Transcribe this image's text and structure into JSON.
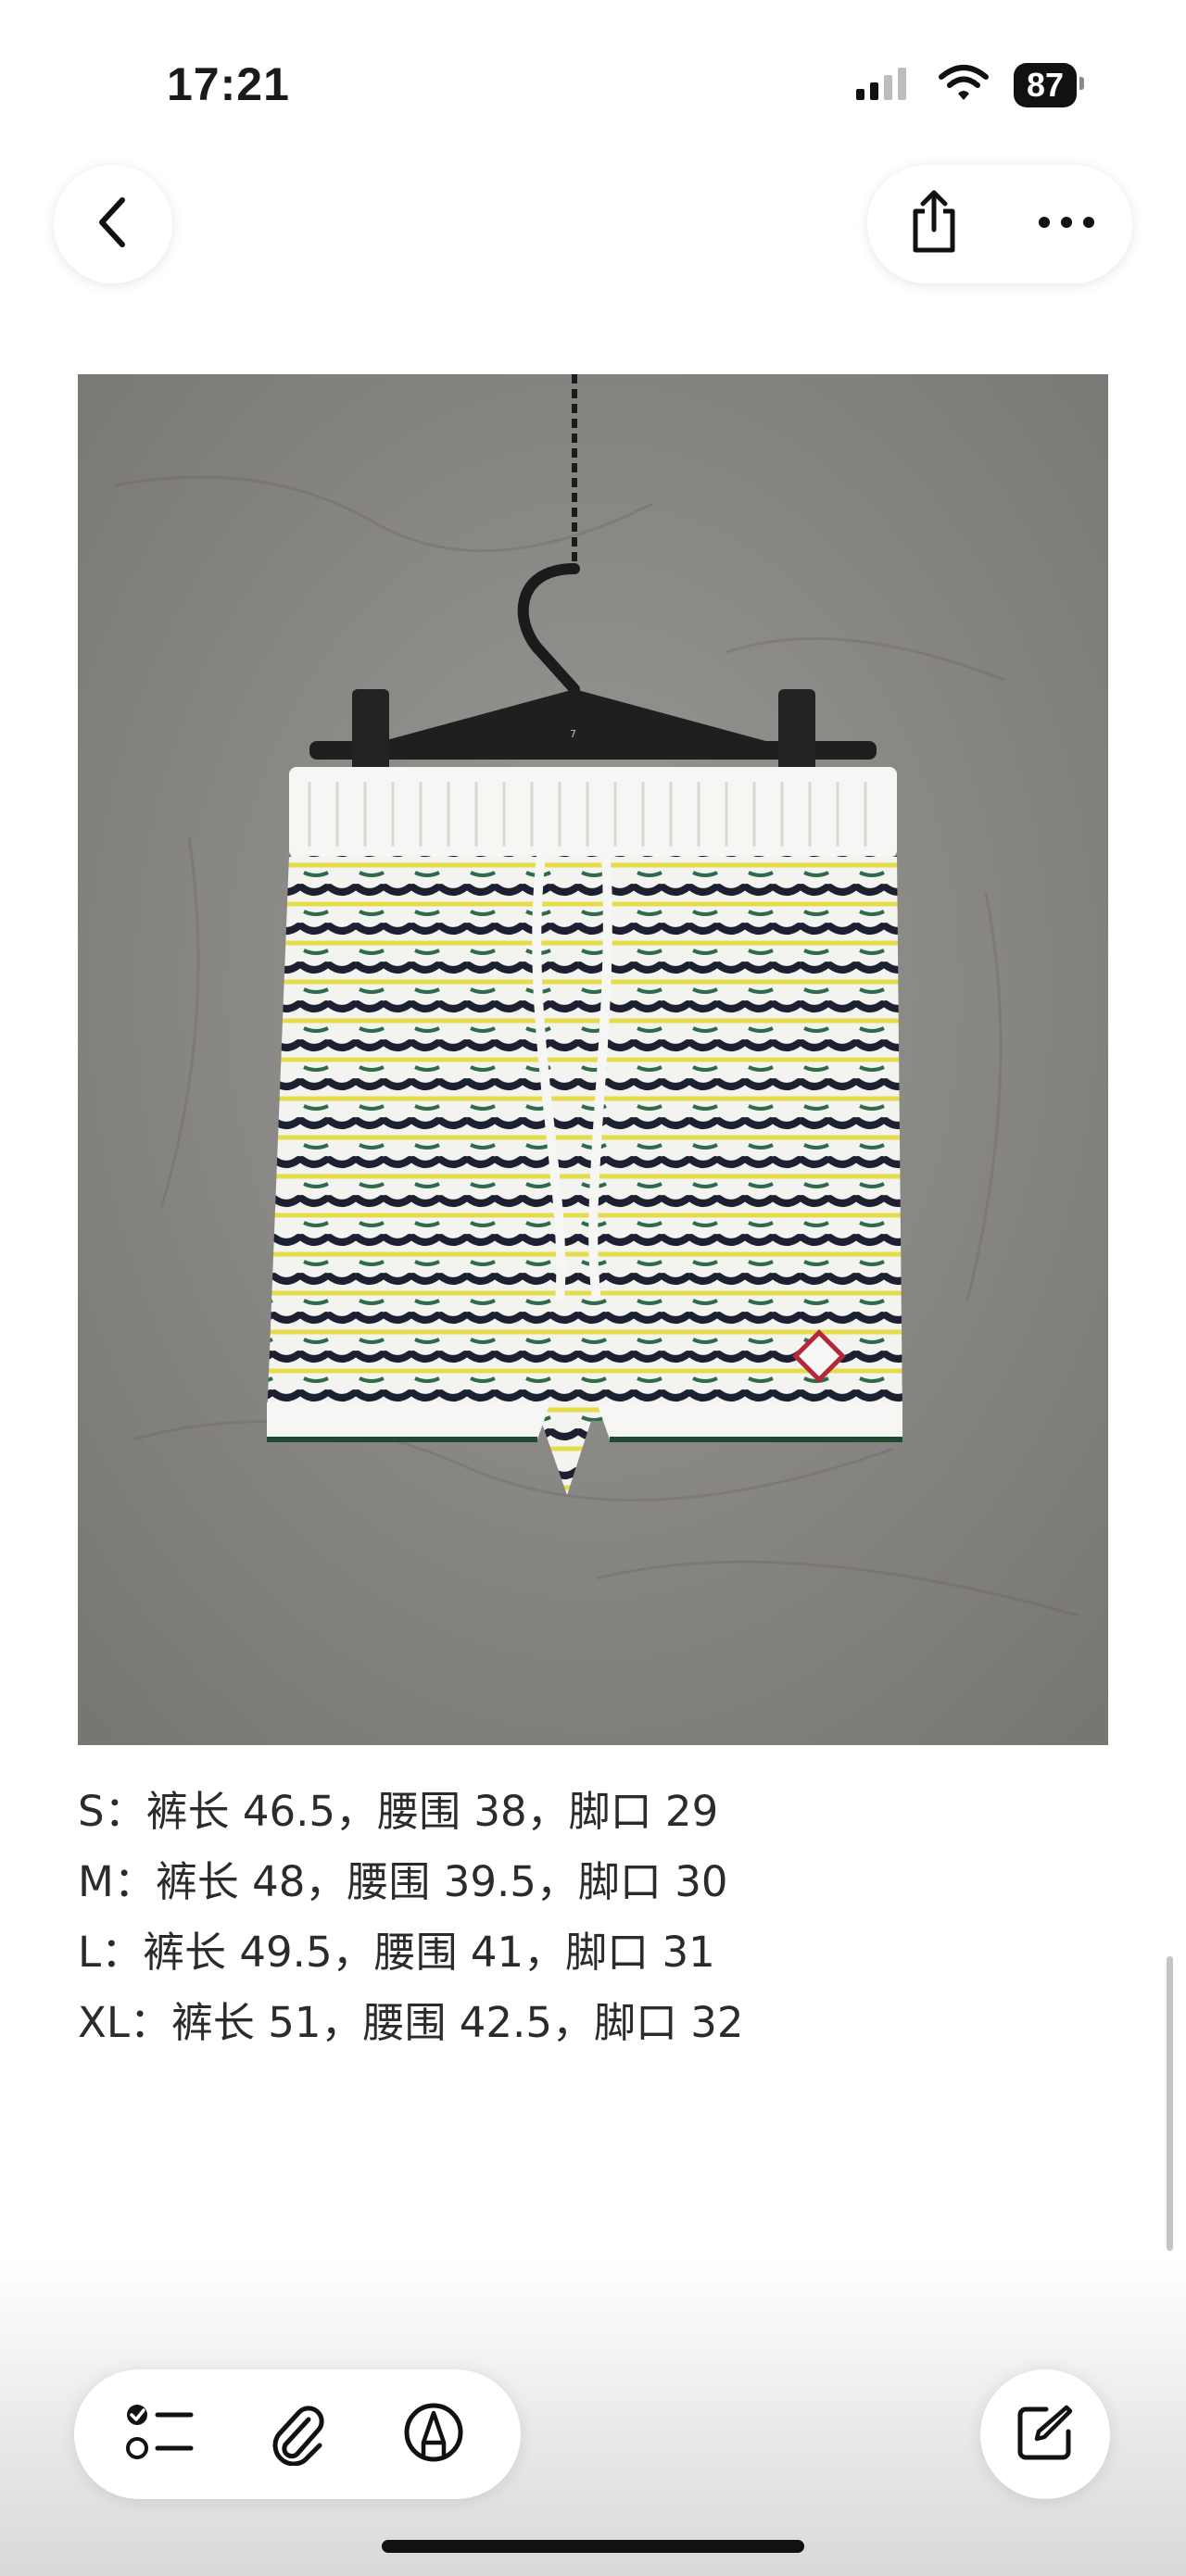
{
  "status_bar": {
    "time": "17:21",
    "battery": "87",
    "icons": [
      "cellular-signal-icon",
      "wifi-icon",
      "battery-icon"
    ]
  },
  "nav": {
    "back_icon": "chevron-left-icon",
    "share_icon": "share-icon",
    "more_icon": "ellipsis-icon"
  },
  "photo": {
    "hanger_tag": "7"
  },
  "size_chart": [
    "S：裤长 46.5，腰围 38，脚口 29",
    "M：裤长 48，腰围 39.5，脚口 30",
    "L：裤长 49.5，腰围 41，脚口 31",
    "XL：裤长 51，腰围 42.5，脚口 32"
  ],
  "toolbar": {
    "checklist_icon": "checklist-icon",
    "attachment_icon": "paperclip-icon",
    "markup_icon": "pen-markup-icon",
    "compose_icon": "compose-icon"
  }
}
